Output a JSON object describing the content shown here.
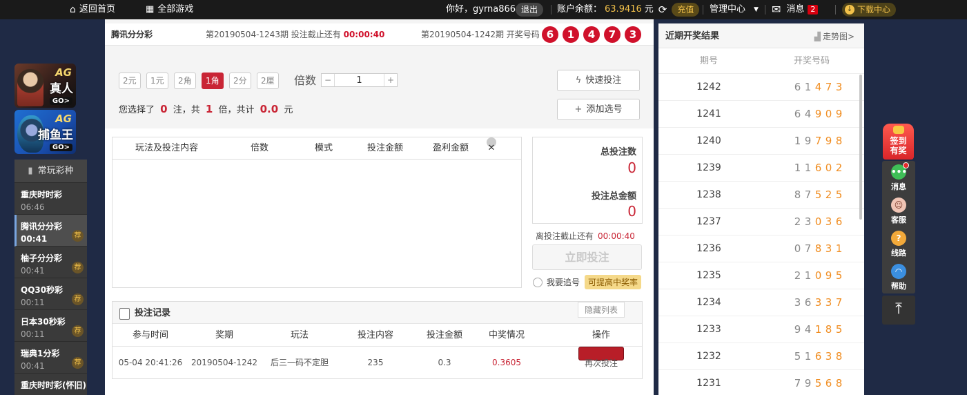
{
  "topbar": {
    "home": "返回首页",
    "all_games": "全部游戏",
    "greeting": "你好，gyrna866",
    "logout": "退出",
    "balance_label": "账户余额：",
    "balance": "63.9416",
    "currency": "元",
    "recharge": "充值",
    "manage": "管理中心",
    "messages": "消息",
    "message_count": "2",
    "download": "下载中心"
  },
  "ag_banners": [
    {
      "brand": "AG",
      "name": "真人",
      "go": "GO>"
    },
    {
      "brand": "AG",
      "name": "捕鱼王",
      "go": "GO>"
    }
  ],
  "sidebar": {
    "header": "常玩彩种",
    "rec_label": "荐",
    "items": [
      {
        "name": "重庆时时彩",
        "time": "06:46"
      },
      {
        "name": "腾讯分分彩",
        "time": "00:41"
      },
      {
        "name": "柚子分分彩",
        "time": "00:41"
      },
      {
        "name": "QQ30秒彩",
        "time": "00:11"
      },
      {
        "name": "日本30秒彩",
        "time": "00:11"
      },
      {
        "name": "瑞典1分彩",
        "time": "00:41"
      },
      {
        "name": "重庆时时彩(怀旧)",
        "time": ""
      }
    ]
  },
  "lottery": {
    "name": "腾讯分分彩",
    "current_period": "第20190504-1243期 投注截止还有",
    "countdown": "00:00:40",
    "last_period": "第20190504-1242期 开奖号码",
    "last_numbers": [
      "6",
      "1",
      "4",
      "7",
      "3"
    ]
  },
  "bet": {
    "units": [
      "2元",
      "1元",
      "2角",
      "1角",
      "2分",
      "2厘"
    ],
    "active_unit": "1角",
    "multiplier_label": "倍数",
    "multiplier_value": "1",
    "summary_prefix": "您选择了",
    "count": "0",
    "count_unit": "注，共",
    "times": "1",
    "times_unit": "倍，共计",
    "amount": "0.0",
    "amount_unit": "元",
    "quick_bet": "快速投注",
    "add_selection": "添加选号"
  },
  "cart": {
    "columns": [
      "玩法及投注内容",
      "倍数",
      "模式",
      "投注金额",
      "盈利金额"
    ]
  },
  "totals": {
    "count_label": "总投注数",
    "count_value": "0",
    "amount_label": "投注总金额",
    "amount_value": "0",
    "deadline_label": "离投注截止还有",
    "deadline": "00:00:40",
    "submit": "立即投注",
    "chase": "我要追号",
    "chase_tip": "可提高中奖率"
  },
  "records": {
    "title": "投注记录",
    "hide": "隐藏列表",
    "columns": [
      "参与时间",
      "奖期",
      "玩法",
      "投注内容",
      "投注金额",
      "中奖情况",
      "操作"
    ],
    "rows": [
      {
        "time": "05-04 20:41:26",
        "period": "20190504-1242",
        "play": "后三一码不定胆",
        "content": "235",
        "amount": "0.3",
        "win": "0.3605",
        "action": "再次投注"
      }
    ]
  },
  "results": {
    "title": "近期开奖结果",
    "trend": "走势图>",
    "col_period": "期号",
    "col_numbers": "开奖号码",
    "rows": [
      {
        "period": "1242",
        "nums": [
          "6",
          "1",
          "4",
          "7",
          "3"
        ]
      },
      {
        "period": "1241",
        "nums": [
          "6",
          "4",
          "9",
          "0",
          "9"
        ]
      },
      {
        "period": "1240",
        "nums": [
          "1",
          "9",
          "7",
          "9",
          "8"
        ]
      },
      {
        "period": "1239",
        "nums": [
          "1",
          "1",
          "6",
          "0",
          "2"
        ]
      },
      {
        "period": "1238",
        "nums": [
          "8",
          "7",
          "5",
          "2",
          "5"
        ]
      },
      {
        "period": "1237",
        "nums": [
          "2",
          "3",
          "0",
          "3",
          "6"
        ]
      },
      {
        "period": "1236",
        "nums": [
          "0",
          "7",
          "8",
          "3",
          "1"
        ]
      },
      {
        "period": "1235",
        "nums": [
          "2",
          "1",
          "0",
          "9",
          "5"
        ]
      },
      {
        "period": "1234",
        "nums": [
          "3",
          "6",
          "3",
          "3",
          "7"
        ]
      },
      {
        "period": "1233",
        "nums": [
          "9",
          "4",
          "1",
          "8",
          "5"
        ]
      },
      {
        "period": "1232",
        "nums": [
          "5",
          "1",
          "6",
          "3",
          "8"
        ]
      },
      {
        "period": "1231",
        "nums": [
          "7",
          "9",
          "5",
          "6",
          "8"
        ]
      }
    ]
  },
  "side_tools": {
    "sign_line1": "签到",
    "sign_line2": "有奖",
    "items": [
      "消息",
      "客服",
      "线路",
      "帮助"
    ],
    "top": "⇞"
  },
  "colors": {
    "accent_red": "#c92535",
    "gold": "#f2c14a",
    "orange_number": "#f08c1f"
  }
}
